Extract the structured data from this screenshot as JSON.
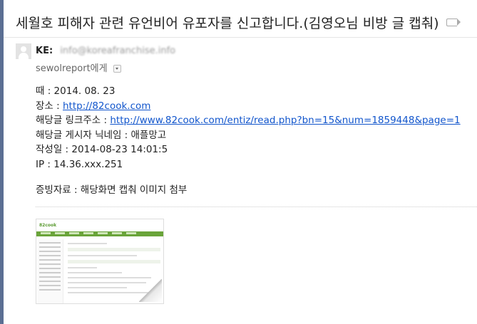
{
  "email": {
    "subject": "세월호 피해자 관련 유언비어 유포자를 신고합니다.(김영오님 비방 글 캡춰)",
    "sender": {
      "name": "KE:",
      "email": "info@koreafranchise.info"
    },
    "recipient_line": "sewolreport에게",
    "body": {
      "date_line": "때 : 2014. 08. 23",
      "place_label": "장소 : ",
      "place_link": "http://82cook.com",
      "post_link_label": "해당글 링크주소 : ",
      "post_link": "http://www.82cook.com/entiz/read.php?bn=15&num=1859448&page=1",
      "author_line": "해당글 게시자 닉네임 : 애플망고",
      "created_line": "작성일 : 2014-08-23 14:01:5",
      "ip_line": "IP : 14.36.xxx.251",
      "evidence_line": "증빙자료 : 해당화면 캡춰 이미지 첨부"
    },
    "attachment": {
      "thumbnail_logo": "82cook"
    }
  },
  "colors": {
    "link": "#1155cc",
    "side_edge": "#5b6f93",
    "thumb_nav": "#6aa43a"
  }
}
